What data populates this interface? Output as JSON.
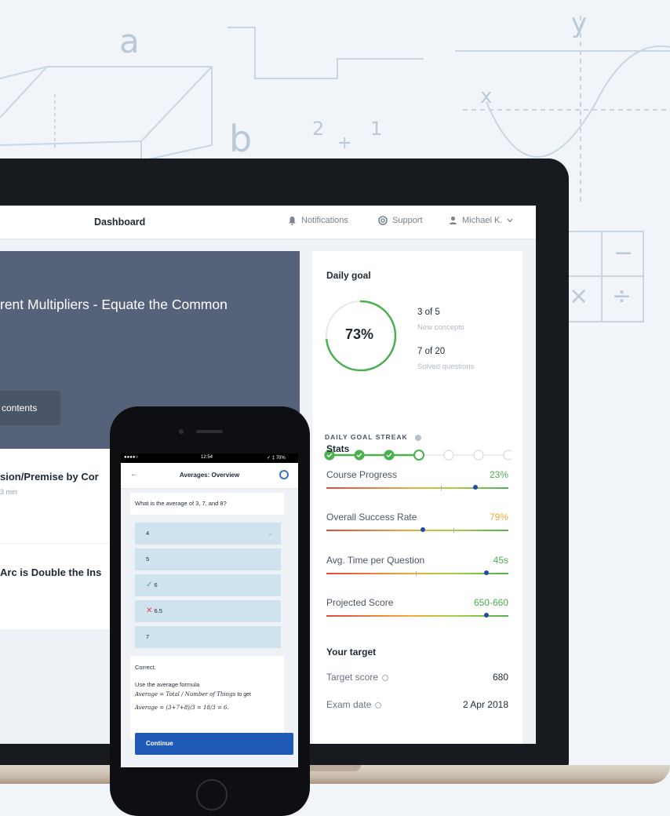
{
  "background": {
    "math": [
      "a",
      "b",
      "y",
      "x",
      "2",
      "1",
      "+",
      "−",
      "×",
      "÷"
    ]
  },
  "app": {
    "title": "Dashboard",
    "nav": [
      {
        "label": "Notifications",
        "icon": "bell-icon"
      },
      {
        "label": "Support",
        "icon": "lifebuoy-icon"
      },
      {
        "label": "Michael K.",
        "icon": "user-icon"
      }
    ]
  },
  "hero": {
    "title": "rent Multipliers - Equate the Common",
    "button": "contents"
  },
  "lessons": [
    {
      "title": "sion/Premise by Cor",
      "meta": "3 min"
    },
    {
      "title": "Arc is Double the Ins"
    }
  ],
  "daily_goal": {
    "heading": "Daily goal",
    "percent_label": "73%",
    "progress": 0.73,
    "concepts_value": "3 of 5",
    "concepts_label": "New concepts",
    "questions_value": "7 of 20",
    "questions_label": "Solved questions",
    "streak_heading": "DAILY GOAL STREAK",
    "streak_completed": 3,
    "streak_today": 1,
    "streak_total": 7
  },
  "stats": {
    "heading": "Stats",
    "items": [
      {
        "label": "Course Progress",
        "value": "23%",
        "color": "#4caf50",
        "marker": 0.82
      },
      {
        "label": "Overall Success Rate",
        "value": "79%",
        "color": "#f0a93a",
        "marker": 0.53
      },
      {
        "label": "Avg. Time per Question",
        "value": "45s",
        "color": "#4caf50",
        "marker": 0.88
      },
      {
        "label": "Projected Score",
        "value": "650-660",
        "color": "#4caf50",
        "marker": 0.88
      }
    ]
  },
  "target": {
    "heading": "Your target",
    "score_label": "Target score",
    "score_value": "680",
    "date_label": "Exam date",
    "date_value": "2 Apr 2018"
  },
  "phone": {
    "status_time": "12:54",
    "status_right": "✓ ‡ 70%",
    "title": "Averages: Overview",
    "question": "What is the average of 3, 7, and 8?",
    "options": [
      {
        "label": "4",
        "mark": ""
      },
      {
        "label": "5",
        "mark": ""
      },
      {
        "label": "6",
        "mark": "✓"
      },
      {
        "label": "6.5",
        "mark": "✕"
      },
      {
        "label": "7",
        "mark": ""
      }
    ],
    "feedback_title": "Correct.",
    "feedback_text": "Use the average formula",
    "formula_1": "Average = Total / Number of Things",
    "formula_1_suffix": "to get",
    "formula_2": "Average = (3+7+8)/3 = 18/3 = 6.",
    "continue": "Continue"
  },
  "colors": {
    "accent": "#1f5bb6",
    "success": "#4caf50",
    "warning": "#f0a93a",
    "error": "#e2483d"
  }
}
